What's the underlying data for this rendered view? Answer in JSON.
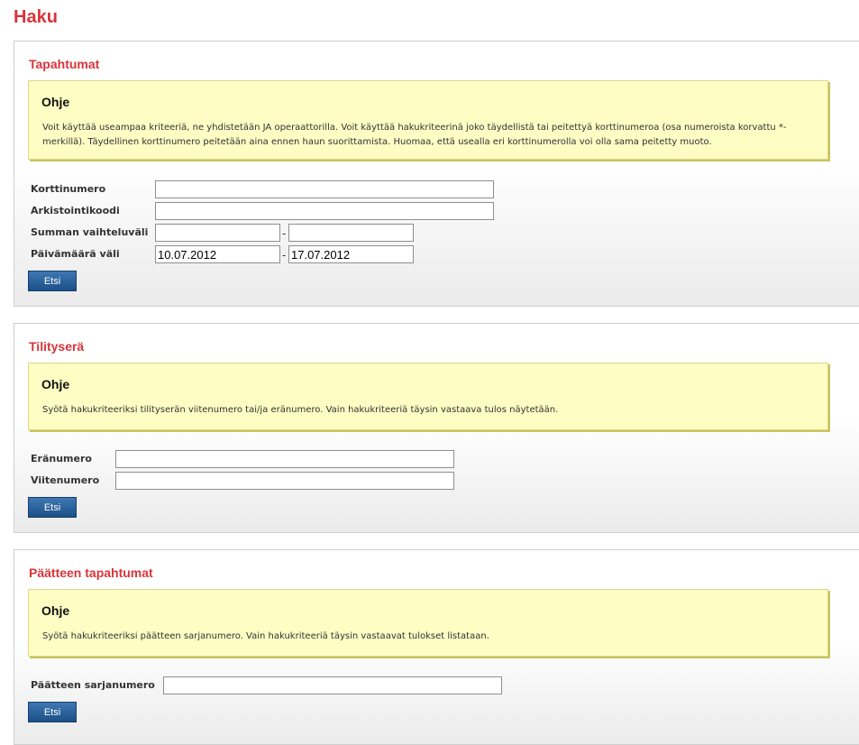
{
  "page": {
    "title": "Haku"
  },
  "sections": {
    "tapahtumat": {
      "title": "Tapahtumat",
      "help_title": "Ohje",
      "help_text": "Voit käyttää useampaa kriteeriä, ne yhdistetään JA operaattorilla. Voit käyttää hakukriteerinä joko täydellistä tai peitettyä korttinumeroa (osa numeroista korvattu *-merkillä). Täydellinen korttinumero peitetään aina ennen haun suorittamista. Huomaa, että usealla eri korttinumerolla voi olla sama peitetty muoto.",
      "fields": {
        "korttinumero": {
          "label": "Korttinumero",
          "value": ""
        },
        "arkistointikoodi": {
          "label": "Arkistointikoodi",
          "value": ""
        },
        "summa": {
          "label": "Summan vaihteluväli",
          "from": "",
          "to": "",
          "separator": "-"
        },
        "paivamaara": {
          "label": "Päivämäärä väli",
          "from": "10.07.2012",
          "to": "17.07.2012",
          "separator": "-"
        }
      },
      "search_label": "Etsi"
    },
    "tilitysera": {
      "title": "Tilityserä",
      "help_title": "Ohje",
      "help_text": "Syötä hakukriteeriksi tilityserän viitenumero tai/ja eränumero. Vain hakukriteeriä täysin vastaava tulos näytetään.",
      "fields": {
        "eranumero": {
          "label": "Eränumero",
          "value": ""
        },
        "viitenumero": {
          "label": "Viitenumero",
          "value": ""
        }
      },
      "search_label": "Etsi"
    },
    "paatteen": {
      "title": "Päätteen tapahtumat",
      "help_title": "Ohje",
      "help_text": "Syötä hakukriteeriksi päätteen sarjanumero. Vain hakukriteeriä täysin vastaavat tulokset listataan.",
      "fields": {
        "sarjanumero": {
          "label": "Päätteen sarjanumero",
          "value": ""
        }
      },
      "search_label": "Etsi"
    }
  },
  "colors": {
    "heading_red": "#d9343a",
    "help_background": "#fefdc4",
    "button_blue": "#2a5f98"
  }
}
